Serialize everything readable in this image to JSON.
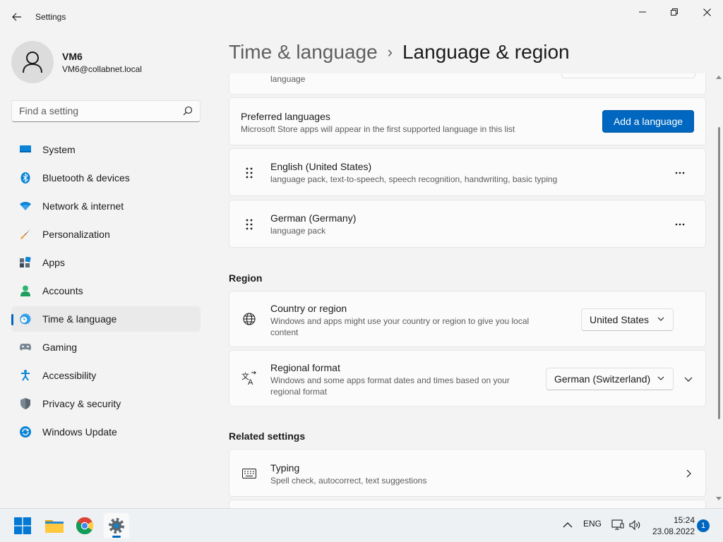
{
  "window": {
    "title": "Settings"
  },
  "profile": {
    "name": "VM6",
    "email": "VM6@collabnet.local"
  },
  "search": {
    "placeholder": "Find a setting"
  },
  "sidebar": {
    "items": [
      {
        "label": "System",
        "icon": "monitor-icon"
      },
      {
        "label": "Bluetooth & devices",
        "icon": "bluetooth-icon"
      },
      {
        "label": "Network & internet",
        "icon": "wifi-icon"
      },
      {
        "label": "Personalization",
        "icon": "brush-icon"
      },
      {
        "label": "Apps",
        "icon": "apps-icon"
      },
      {
        "label": "Accounts",
        "icon": "person-icon"
      },
      {
        "label": "Time & language",
        "icon": "globe-clock-icon"
      },
      {
        "label": "Gaming",
        "icon": "gamepad-icon"
      },
      {
        "label": "Accessibility",
        "icon": "accessibility-icon"
      },
      {
        "label": "Privacy & security",
        "icon": "shield-icon"
      },
      {
        "label": "Windows Update",
        "icon": "update-icon"
      }
    ],
    "active_index": 6
  },
  "breadcrumb": {
    "parent": "Time & language",
    "separator": "›",
    "current": "Language & region"
  },
  "content": {
    "top_card_sub": "language",
    "preferred": {
      "title": "Preferred languages",
      "subtitle": "Microsoft Store apps will appear in the first supported language in this list",
      "button": "Add a language"
    },
    "languages": [
      {
        "name": "English (United States)",
        "detail": "language pack, text-to-speech, speech recognition, handwriting, basic typing",
        "more": "···"
      },
      {
        "name": "German (Germany)",
        "detail": "language pack",
        "more": "···"
      }
    ],
    "region_header": "Region",
    "country": {
      "title": "Country or region",
      "subtitle_line1": "Windows and apps might use your country or region to give you local",
      "subtitle_line2": "content",
      "value": "United States"
    },
    "regional_format": {
      "title": "Regional format",
      "subtitle_line1": "Windows and some apps format dates and times based on your",
      "subtitle_line2": "regional format",
      "value": "German (Switzerland)"
    },
    "related_header": "Related settings",
    "typing": {
      "title": "Typing",
      "subtitle": "Spell check, autocorrect, text suggestions"
    }
  },
  "taskbar": {
    "apps": [
      "start-icon",
      "file-explorer-icon",
      "chrome-icon",
      "settings-icon"
    ],
    "tray": {
      "language": "ENG",
      "time": "15:24",
      "date": "23.08.2022",
      "notifications": "1"
    }
  },
  "colors": {
    "accent": "#0067c0",
    "background": "#f3f3f3",
    "card": "#fbfbfb"
  }
}
